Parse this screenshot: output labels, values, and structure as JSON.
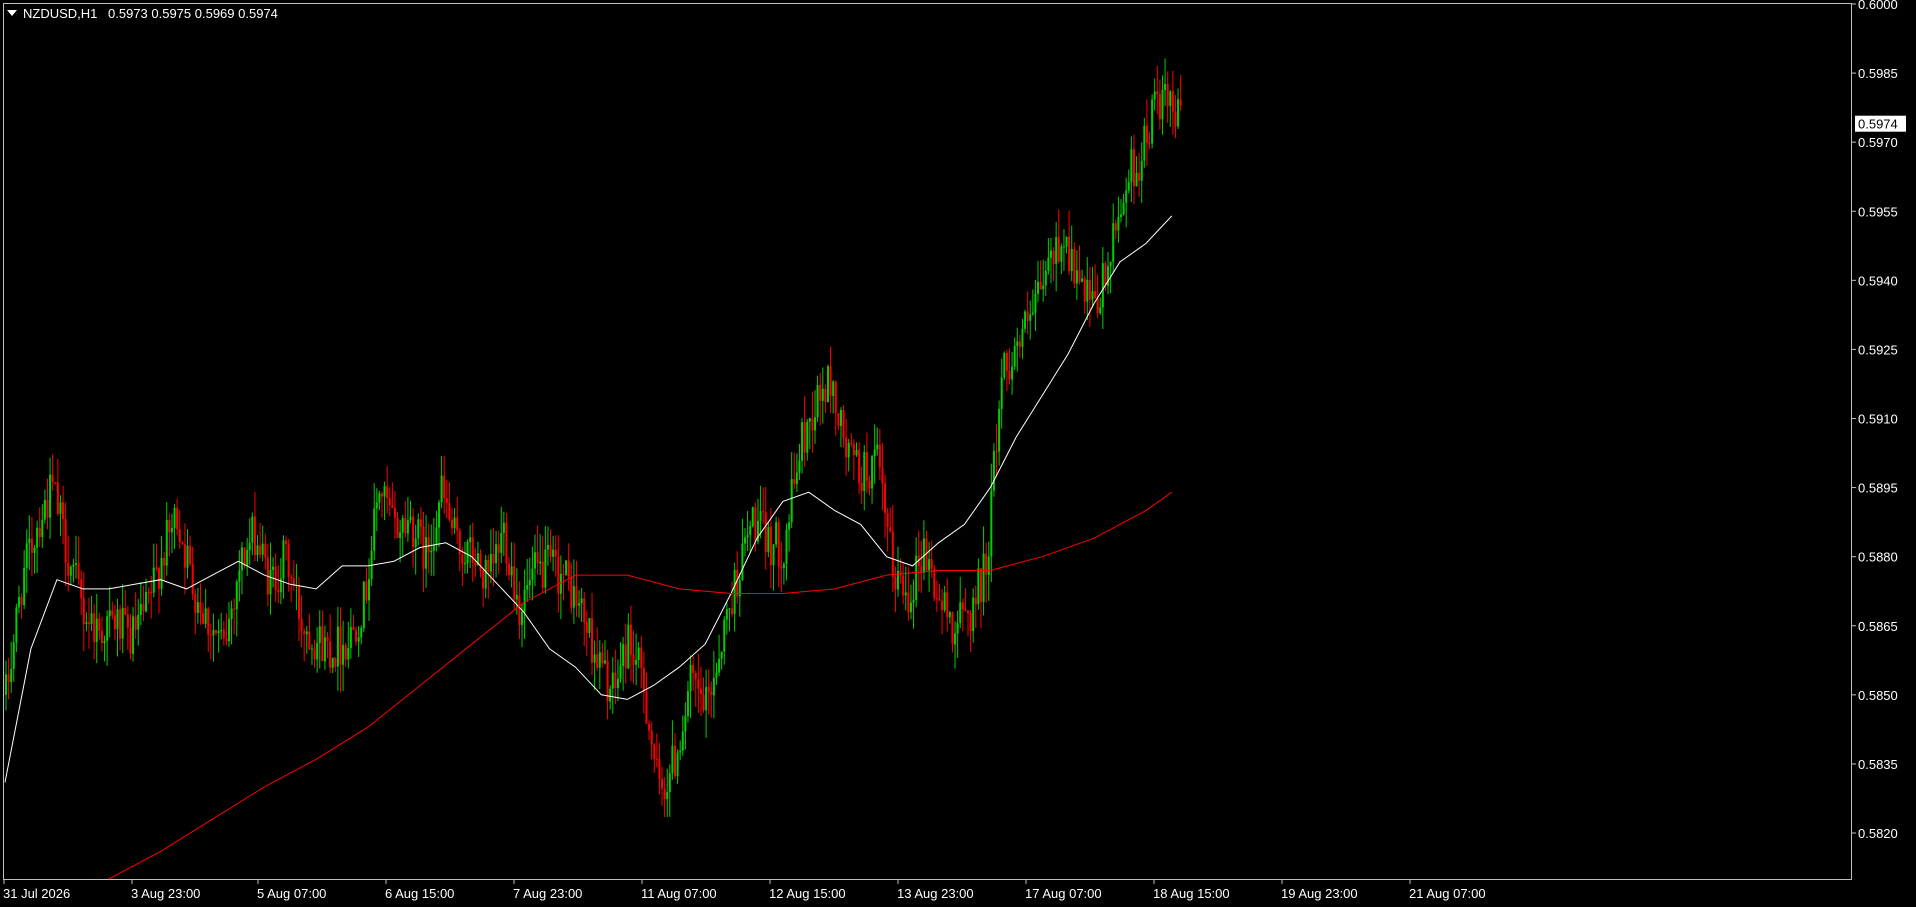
{
  "header": {
    "symbol_timeframe": "NZDUSD,H1",
    "ohlc": "0.5973 0.5975 0.5969 0.5974"
  },
  "price_marker": {
    "label": "0.5974",
    "value": 0.5974
  },
  "colors": {
    "background": "#000000",
    "frame": "#c0c0c0",
    "bull_candle": "#00d000",
    "bear_candle": "#ff0000",
    "ma_fast": "#ffffff",
    "ma_slow": "#ff0000"
  },
  "chart_data": {
    "type": "candlestick",
    "symbol": "NZDUSD",
    "timeframe": "H1",
    "ylim": [
      0.581,
      0.6
    ],
    "y_ticks": [
      "0.6000",
      "0.5985",
      "0.5970",
      "0.5955",
      "0.5940",
      "0.5925",
      "0.5910",
      "0.5895",
      "0.5880",
      "0.5865",
      "0.5850",
      "0.5835",
      "0.5820"
    ],
    "x_tick_labels": [
      "31 Jul 2026",
      "3 Aug 23:00",
      "5 Aug 07:00",
      "6 Aug 15:00",
      "7 Aug 23:00",
      "11 Aug 07:00",
      "12 Aug 15:00",
      "13 Aug 23:00",
      "17 Aug 07:00",
      "18 Aug 15:00",
      "19 Aug 23:00",
      "21 Aug 07:00"
    ],
    "close_path": [
      [
        0,
        0.585
      ],
      [
        6,
        0.5874
      ],
      [
        12,
        0.5887
      ],
      [
        18,
        0.5895
      ],
      [
        24,
        0.588
      ],
      [
        30,
        0.5868
      ],
      [
        36,
        0.5864
      ],
      [
        42,
        0.5866
      ],
      [
        48,
        0.5862
      ],
      [
        54,
        0.5868
      ],
      [
        60,
        0.588
      ],
      [
        66,
        0.5889
      ],
      [
        72,
        0.5874
      ],
      [
        78,
        0.5866
      ],
      [
        84,
        0.586
      ],
      [
        90,
        0.5878
      ],
      [
        96,
        0.5885
      ],
      [
        102,
        0.5874
      ],
      [
        108,
        0.588
      ],
      [
        114,
        0.5866
      ],
      [
        120,
        0.5862
      ],
      [
        126,
        0.586
      ],
      [
        132,
        0.5862
      ],
      [
        138,
        0.587
      ],
      [
        144,
        0.5895
      ],
      [
        150,
        0.5886
      ],
      [
        156,
        0.5888
      ],
      [
        162,
        0.588
      ],
      [
        168,
        0.5894
      ],
      [
        174,
        0.5882
      ],
      [
        180,
        0.588
      ],
      [
        186,
        0.5874
      ],
      [
        192,
        0.5886
      ],
      [
        198,
        0.5869
      ],
      [
        204,
        0.5876
      ],
      [
        210,
        0.5878
      ],
      [
        216,
        0.5875
      ],
      [
        222,
        0.5868
      ],
      [
        228,
        0.5858
      ],
      [
        234,
        0.585
      ],
      [
        240,
        0.5862
      ],
      [
        246,
        0.5852
      ],
      [
        252,
        0.5828
      ],
      [
        258,
        0.5836
      ],
      [
        264,
        0.5852
      ],
      [
        270,
        0.5847
      ],
      [
        276,
        0.5862
      ],
      [
        282,
        0.5876
      ],
      [
        288,
        0.5888
      ],
      [
        294,
        0.5883
      ],
      [
        300,
        0.5882
      ],
      [
        306,
        0.5903
      ],
      [
        312,
        0.5913
      ],
      [
        318,
        0.5918
      ],
      [
        324,
        0.5903
      ],
      [
        330,
        0.5898
      ],
      [
        336,
        0.59
      ],
      [
        342,
        0.5877
      ],
      [
        348,
        0.5872
      ],
      [
        354,
        0.5882
      ],
      [
        360,
        0.587
      ],
      [
        366,
        0.5865
      ],
      [
        372,
        0.5868
      ],
      [
        378,
        0.5878
      ],
      [
        384,
        0.592
      ],
      [
        390,
        0.5926
      ],
      [
        396,
        0.5932
      ],
      [
        402,
        0.5943
      ],
      [
        408,
        0.595
      ],
      [
        414,
        0.5938
      ],
      [
        420,
        0.5933
      ],
      [
        426,
        0.5945
      ],
      [
        432,
        0.5962
      ],
      [
        438,
        0.5967
      ],
      [
        444,
        0.598
      ],
      [
        450,
        0.5976
      ],
      [
        453,
        0.5974
      ]
    ],
    "series": [
      {
        "name": "",
        "line_type": "moving-average",
        "color": "#ffffff",
        "x": [
          0,
          10,
          20,
          30,
          40,
          50,
          60,
          70,
          80,
          90,
          100,
          110,
          120,
          130,
          140,
          150,
          160,
          170,
          180,
          190,
          200,
          210,
          220,
          230,
          240,
          250,
          260,
          270,
          280,
          290,
          300,
          310,
          320,
          330,
          340,
          350,
          360,
          370,
          380,
          390,
          400,
          410,
          420,
          430,
          440,
          450
        ],
        "values": [
          0.5831,
          0.586,
          0.5875,
          0.5873,
          0.5873,
          0.5874,
          0.5875,
          0.5873,
          0.5876,
          0.5879,
          0.5876,
          0.5874,
          0.5873,
          0.5878,
          0.5878,
          0.5879,
          0.5882,
          0.5883,
          0.588,
          0.5874,
          0.5868,
          0.586,
          0.5856,
          0.585,
          0.5849,
          0.5852,
          0.5856,
          0.5861,
          0.5872,
          0.5884,
          0.5892,
          0.5894,
          0.589,
          0.5887,
          0.588,
          0.5878,
          0.5883,
          0.5887,
          0.5895,
          0.5906,
          0.5915,
          0.5924,
          0.5935,
          0.5944,
          0.5948,
          0.5954
        ]
      },
      {
        "name": "",
        "line_type": "moving-average",
        "color": "#ff0000",
        "x": [
          40,
          60,
          80,
          100,
          120,
          140,
          160,
          180,
          200,
          220,
          240,
          260,
          280,
          300,
          320,
          340,
          360,
          380,
          400,
          420,
          440,
          450
        ],
        "values": [
          0.581,
          0.5816,
          0.5823,
          0.583,
          0.5836,
          0.5843,
          0.5852,
          0.5861,
          0.587,
          0.5876,
          0.5876,
          0.5873,
          0.5872,
          0.5872,
          0.5873,
          0.5876,
          0.5877,
          0.5877,
          0.588,
          0.5884,
          0.589,
          0.5894
        ]
      }
    ]
  }
}
